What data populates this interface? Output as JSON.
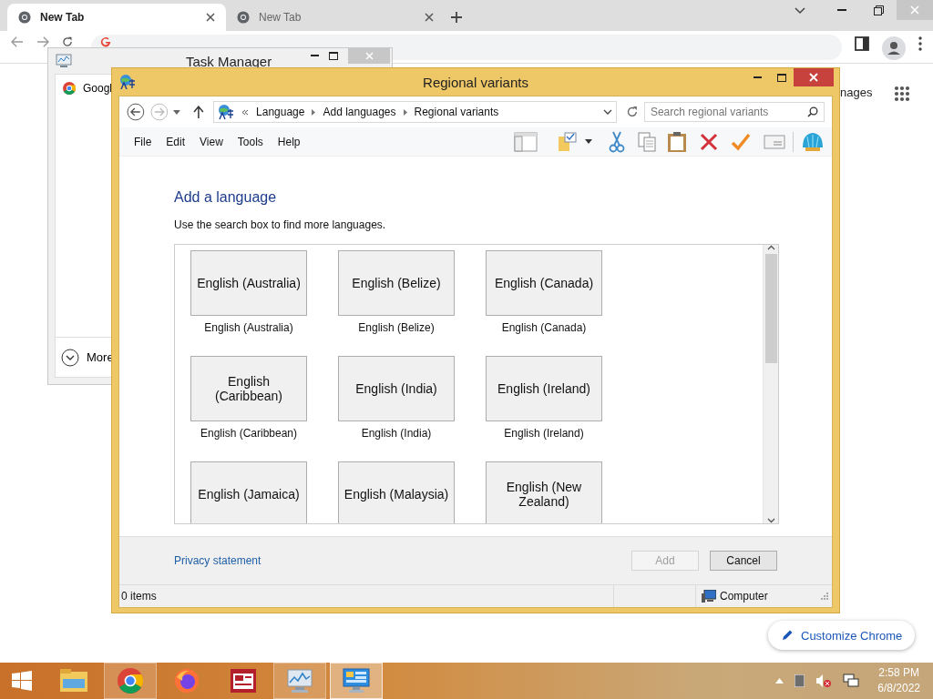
{
  "browser": {
    "tabs": [
      {
        "label": "New Tab",
        "selected": true
      },
      {
        "label": "New Tab",
        "selected": false
      }
    ],
    "page_link": "nages",
    "customize_button": "Customize Chrome"
  },
  "task_manager": {
    "title": "Task Manager",
    "processes": [
      "Googl"
    ],
    "more": "More"
  },
  "dialog": {
    "title": "Regional variants",
    "breadcrumb": [
      "Language",
      "Add languages",
      "Regional variants"
    ],
    "search_placeholder": "Search regional variants",
    "menu": [
      "File",
      "Edit",
      "View",
      "Tools",
      "Help"
    ],
    "heading": "Add a language",
    "instruction": "Use the search box to find more languages.",
    "languages": [
      {
        "tile": "English (Australia)",
        "caption": "English (Australia)"
      },
      {
        "tile": "English (Belize)",
        "caption": "English (Belize)"
      },
      {
        "tile": "English (Canada)",
        "caption": "English (Canada)"
      },
      {
        "tile": "English (Caribbean)",
        "caption": "English (Caribbean)"
      },
      {
        "tile": "English (India)",
        "caption": "English (India)"
      },
      {
        "tile": "English (Ireland)",
        "caption": "English (Ireland)"
      },
      {
        "tile": "English (Jamaica)"
      },
      {
        "tile": "English (Malaysia)"
      },
      {
        "tile": "English (New Zealand)"
      }
    ],
    "privacy_link": "Privacy statement",
    "buttons": [
      {
        "label": "Add",
        "disabled": true
      },
      {
        "label": "Cancel",
        "disabled": false
      }
    ],
    "status": {
      "items": "0 items",
      "location": "Computer"
    }
  },
  "taskbar": {
    "apps": [
      {
        "kind": "explorer",
        "open": false,
        "selected": false
      },
      {
        "kind": "chrome",
        "open": true,
        "selected": false
      },
      {
        "kind": "firefox",
        "open": false,
        "selected": false
      },
      {
        "kind": "news",
        "open": false,
        "selected": false
      },
      {
        "kind": "taskmgr",
        "open": true,
        "selected": false
      },
      {
        "kind": "control",
        "open": true,
        "selected": true
      }
    ],
    "clock": {
      "time": "2:58 PM",
      "date": "6/8/2022"
    }
  }
}
